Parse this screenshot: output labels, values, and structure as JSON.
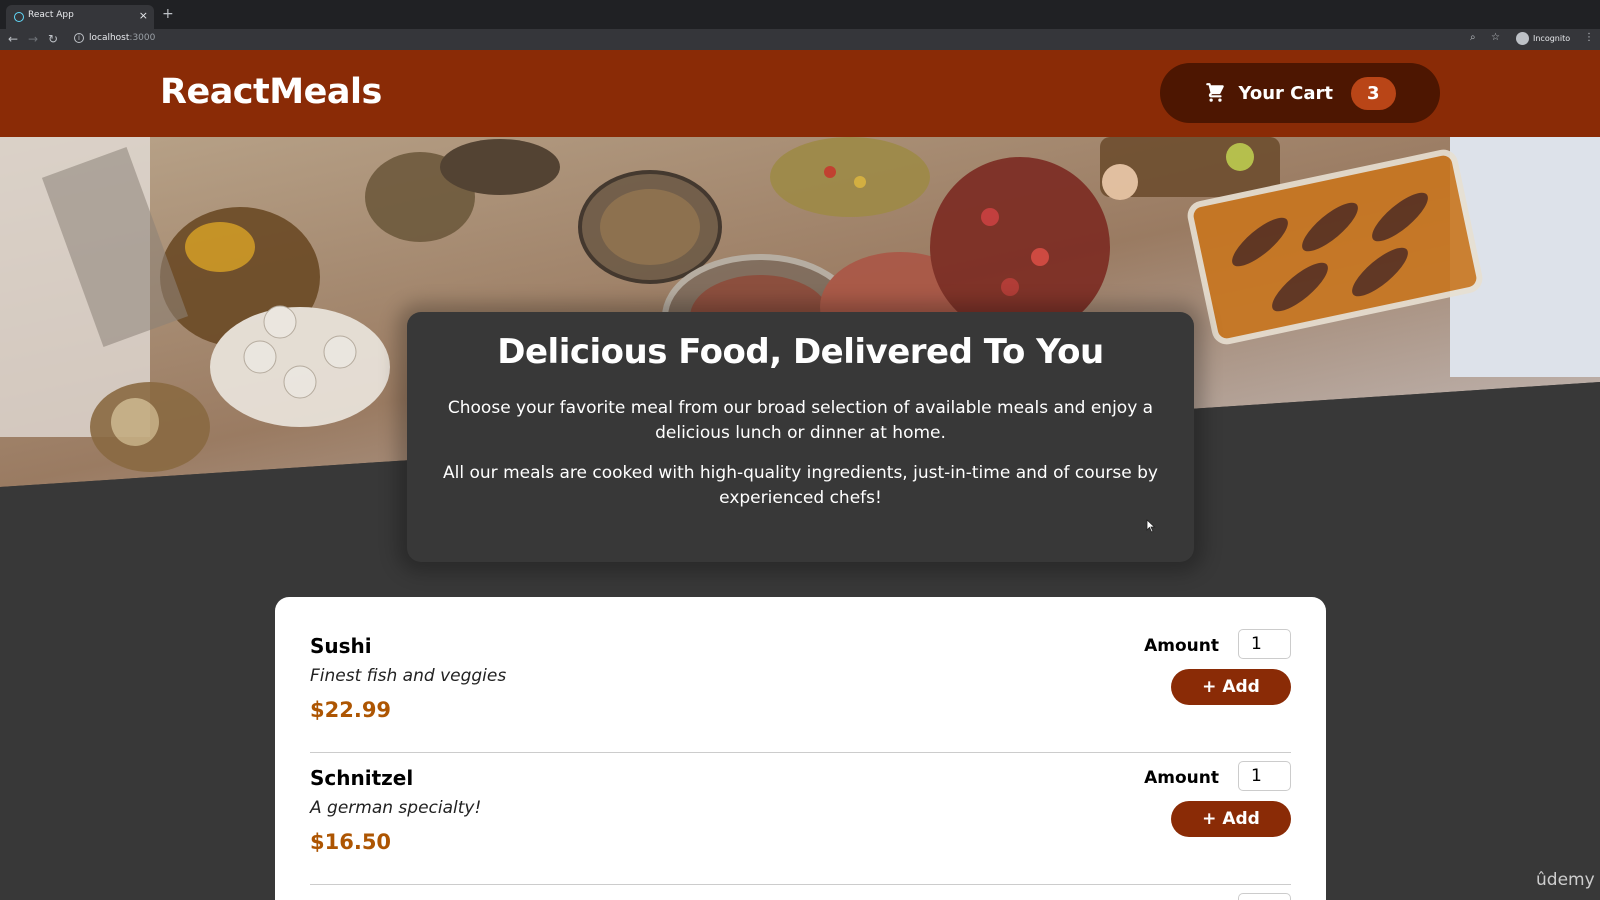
{
  "browser": {
    "tab_title": "React App",
    "tab_close": "×",
    "new_tab": "+",
    "url_host": "localhost",
    "url_port": ":3000",
    "profile_label": "Incognito",
    "icons": [
      "back-icon",
      "forward-icon",
      "reload-icon",
      "info-icon",
      "zoom-icon",
      "star-icon",
      "incognito-icon",
      "menu-icon"
    ]
  },
  "header": {
    "logo": "ReactMeals",
    "cart": {
      "label": "Your Cart",
      "count": "3",
      "icon": "cart-icon"
    }
  },
  "summary": {
    "title": "Delicious Food, Delivered To You",
    "paragraph1": "Choose your favorite meal from our broad selection of available meals and enjoy a delicious lunch or dinner at home.",
    "paragraph2": "All our meals are cooked with high-quality ingredients, just-in-time and of course by experienced chefs!"
  },
  "meals": [
    {
      "name": "Sushi",
      "description": "Finest fish and veggies",
      "price": "$22.99",
      "amount_label": "Amount",
      "amount": "1",
      "add_label": "+ Add"
    },
    {
      "name": "Schnitzel",
      "description": "A german specialty!",
      "price": "$16.50",
      "amount_label": "Amount",
      "amount": "1",
      "add_label": "+ Add"
    }
  ],
  "watermark": "ûdemy",
  "colors": {
    "header": "#8a2b06",
    "cart_button": "#4d1601",
    "badge": "#b94517",
    "price": "#ad5502",
    "background": "#383838"
  }
}
